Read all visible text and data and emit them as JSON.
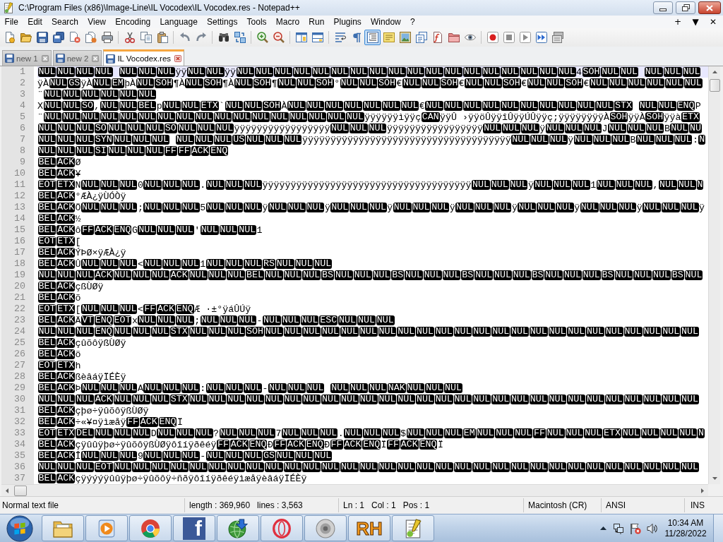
{
  "window": {
    "title": "C:\\Program Files (x86)\\Image-Line\\IL Vocodex\\IL Vocodex.res - Notepad++"
  },
  "menu": {
    "items": [
      "File",
      "Edit",
      "Search",
      "View",
      "Encoding",
      "Language",
      "Settings",
      "Tools",
      "Macro",
      "Run",
      "Plugins",
      "Window",
      "?"
    ],
    "controls": [
      "+",
      "▼",
      "✕"
    ]
  },
  "toolbar": {
    "groups": [
      {
        "buttons": [
          {
            "on": false
          },
          {
            "on": false
          },
          {
            "on": false
          },
          {
            "on": false
          },
          {
            "on": false
          },
          {
            "on": false
          },
          {
            "on": false
          }
        ]
      },
      {
        "buttons": [
          {
            "on": false
          },
          {
            "on": false
          },
          {
            "on": false
          }
        ]
      },
      {
        "buttons": [
          {
            "on": false
          },
          {
            "on": false
          }
        ]
      },
      {
        "buttons": [
          {
            "on": false
          },
          {
            "on": false
          }
        ]
      },
      {
        "buttons": [
          {
            "on": false
          },
          {
            "on": false
          }
        ]
      },
      {
        "buttons": [
          {
            "on": false
          },
          {
            "on": false
          }
        ]
      },
      {
        "buttons": [
          {
            "on": false
          },
          {
            "on": false
          },
          {
            "on": true
          },
          {
            "on": false
          },
          {
            "on": false
          },
          {
            "on": false
          },
          {
            "on": false
          },
          {
            "on": false
          },
          {
            "on": false
          }
        ]
      },
      {
        "buttons": [
          {
            "on": false
          },
          {
            "on": false
          },
          {
            "on": false
          },
          {
            "on": false
          },
          {
            "on": false
          }
        ]
      }
    ]
  },
  "tabs": [
    {
      "label": "new 1",
      "selected": false
    },
    {
      "label": "new 2",
      "selected": false
    },
    {
      "label": "IL Vocodex.res",
      "selected": true
    }
  ],
  "editor": {
    "lines": [
      {
        "number": "1",
        "current": true,
        "segments": [
          {
            "kind": "ctrl",
            "codes": [
              "NUL",
              "NUL",
              "NUL",
              "NUL"
            ]
          },
          {
            "kind": "space"
          },
          {
            "kind": "ctrl",
            "codes": [
              "NUL",
              "NUL",
              "NUL"
            ]
          },
          {
            "kind": "text",
            "text": "ÿÿ"
          },
          {
            "kind": "ctrl",
            "codes": [
              "NUL",
              "NUL"
            ]
          },
          {
            "kind": "text",
            "text": "ÿÿ"
          },
          {
            "kind": "ctrl",
            "codes": [
              "NUL",
              "NUL",
              "NUL",
              "NUL",
              "NUL",
              "NUL",
              "NUL",
              "NUL",
              "NUL",
              "NUL",
              "NUL",
              "NUL",
              "NUL",
              "NUL",
              "NUL",
              "NUL",
              "NUL",
              "NUL"
            ]
          },
          {
            "kind": "text",
            "text": "4"
          },
          {
            "kind": "ctrl",
            "codes": [
              "SOH",
              "NUL",
              "NUL"
            ]
          },
          {
            "kind": "space"
          },
          {
            "kind": "ctrl",
            "codes": [
              "NUL",
              "NUL",
              "NUL"
            ]
          }
        ]
      },
      {
        "number": "2",
        "current": false,
        "segments": [
          {
            "kind": "text",
            "text": "ÿÀ"
          },
          {
            "kind": "ctrl",
            "codes": [
              "NUL",
              "GS"
            ]
          },
          {
            "kind": "text",
            "text": "ÿÀ"
          },
          {
            "kind": "ctrl",
            "codes": [
              "NUL",
              "EM"
            ]
          },
          {
            "kind": "text",
            "text": "þÀ"
          },
          {
            "kind": "ctrl",
            "codes": [
              "NUL",
              "SOH"
            ]
          },
          {
            "kind": "text",
            "text": "¶À"
          },
          {
            "kind": "ctrl",
            "codes": [
              "NUL",
              "SOH"
            ]
          },
          {
            "kind": "text",
            "text": "¶À"
          },
          {
            "kind": "ctrl",
            "codes": [
              "NUL",
              "SOH"
            ]
          },
          {
            "kind": "text",
            "text": "¶"
          },
          {
            "kind": "ctrl",
            "codes": [
              "NUL",
              "NUL",
              "SOH"
            ]
          },
          {
            "kind": "text",
            "text": "°"
          },
          {
            "kind": "ctrl",
            "codes": [
              "NUL",
              "NUL",
              "SOH"
            ]
          },
          {
            "kind": "text",
            "text": "€"
          },
          {
            "kind": "ctrl",
            "codes": [
              "NUL",
              "NUL",
              "SOH"
            ]
          },
          {
            "kind": "text",
            "text": "€"
          },
          {
            "kind": "ctrl",
            "codes": [
              "NUL",
              "NUL",
              "SOH"
            ]
          },
          {
            "kind": "text",
            "text": "€"
          },
          {
            "kind": "ctrl",
            "codes": [
              "NUL",
              "NUL",
              "SOH"
            ]
          },
          {
            "kind": "text",
            "text": "€"
          },
          {
            "kind": "ctrl",
            "codes": [
              "NUL",
              "NUL",
              "NUL",
              "NUL",
              "NUL",
              "NUL"
            ]
          }
        ]
      },
      {
        "number": "3",
        "current": false,
        "segments": [
          {
            "kind": "text",
            "text": "¨"
          },
          {
            "kind": "ctrl",
            "codes": [
              "NUL",
              "NUL",
              "NUL",
              "NUL",
              "NUL",
              "NUL"
            ]
          }
        ]
      },
      {
        "number": "4",
        "current": false,
        "segments": [
          {
            "kind": "text",
            "text": "X"
          },
          {
            "kind": "ctrl",
            "codes": [
              "NUL",
              "NUL",
              "SO"
            ]
          },
          {
            "kind": "text",
            "text": ","
          },
          {
            "kind": "ctrl",
            "codes": [
              "NUL",
              "NUL",
              "BEL"
            ]
          },
          {
            "kind": "text",
            "text": "p"
          },
          {
            "kind": "ctrl",
            "codes": [
              "NUL",
              "NUL",
              "ETX"
            ]
          },
          {
            "kind": "text",
            "text": "`"
          },
          {
            "kind": "ctrl",
            "codes": [
              "NUL",
              "NUL",
              "SOH"
            ]
          },
          {
            "kind": "text",
            "text": "À"
          },
          {
            "kind": "ctrl",
            "codes": [
              "NUL",
              "NUL",
              "NUL",
              "NUL",
              "NUL",
              "NUL",
              "NUL"
            ]
          },
          {
            "kind": "text",
            "text": "€"
          },
          {
            "kind": "ctrl",
            "codes": [
              "NUL",
              "NUL",
              "NUL",
              "NUL",
              "NUL",
              "NUL",
              "NUL",
              "NUL",
              "NUL",
              "NUL",
              "STX"
            ]
          },
          {
            "kind": "space"
          },
          {
            "kind": "ctrl",
            "codes": [
              "NUL",
              "NUL",
              "ENQ"
            ]
          },
          {
            "kind": "text",
            "text": "P"
          }
        ]
      },
      {
        "number": "5",
        "current": false,
        "segments": [
          {
            "kind": "text",
            "text": "¨"
          },
          {
            "kind": "ctrl",
            "codes": [
              "NUL",
              "NUL",
              "NUL",
              "NUL",
              "NUL",
              "NUL",
              "NUL",
              "NUL",
              "NUL",
              "NUL",
              "NUL",
              "NUL",
              "NUL",
              "NUL",
              "NUL",
              "NUL",
              "NUL"
            ]
          },
          {
            "kind": "text",
            "text": "ÿÿÿÿÿÿìÿÿç"
          },
          {
            "kind": "ctrl",
            "codes": [
              "CAN"
            ]
          },
          {
            "kind": "text",
            "text": "ÿÿÛ ›ÿÿöÛÿÿîÛÿÿÚÛÿÿç;ÿÿÿÿÿÿÿÿÀ"
          },
          {
            "kind": "ctrl",
            "codes": [
              "SOH"
            ]
          },
          {
            "kind": "text",
            "text": "ÿÿÀ"
          },
          {
            "kind": "ctrl",
            "codes": [
              "SOH"
            ]
          },
          {
            "kind": "text",
            "text": "ÿÿà"
          },
          {
            "kind": "ctrl",
            "codes": [
              "ETX"
            ]
          }
        ]
      },
      {
        "number": "6",
        "current": false,
        "segments": [
          {
            "kind": "ctrl",
            "codes": [
              "NUL",
              "NUL",
              "NUL",
              "SO",
              "NUL",
              "NUL",
              "NUL",
              "SO",
              "NUL",
              "NUL",
              "NUL"
            ]
          },
          {
            "kind": "text",
            "text": "ÿÿÿÿÿÿÿÿÿÿÿÿÿÿÿÿÿ"
          },
          {
            "kind": "ctrl",
            "codes": [
              "NUL",
              "NUL",
              "NUL"
            ]
          },
          {
            "kind": "text",
            "text": "ÿÿÿÿÿÿÿÿÿÿÿÿÿÿÿÿÿ"
          },
          {
            "kind": "ctrl",
            "codes": [
              "NUL",
              "NUL",
              "NUL"
            ]
          },
          {
            "kind": "text",
            "text": "ÿ"
          },
          {
            "kind": "ctrl",
            "codes": [
              "NUL",
              "NUL",
              "NUL"
            ]
          },
          {
            "kind": "text",
            "text": "J"
          },
          {
            "kind": "ctrl",
            "codes": [
              "NUL",
              "NUL",
              "NUL"
            ]
          },
          {
            "kind": "text",
            "text": "B"
          },
          {
            "kind": "ctrl",
            "codes": [
              "NUL",
              "NU"
            ]
          }
        ]
      },
      {
        "number": "7",
        "current": false,
        "segments": [
          {
            "kind": "ctrl",
            "codes": [
              "NUL",
              "NUL",
              "NUL",
              "SYN",
              "NUL",
              "NUL",
              "NUL"
            ]
          },
          {
            "kind": "space"
          },
          {
            "kind": "ctrl",
            "codes": [
              "NUL",
              "NUL",
              "NUL",
              "US",
              "NUL",
              "NUL",
              "NUL"
            ]
          },
          {
            "kind": "text",
            "text": "ÿÿÿÿÿÿÿÿÿÿÿÿÿÿÿÿÿÿÿÿÿÿÿÿÿÿÿÿÿÿÿÿÿÿÿÿÿ"
          },
          {
            "kind": "ctrl",
            "codes": [
              "NUL",
              "NUL",
              "NUL"
            ]
          },
          {
            "kind": "text",
            "text": "ÿ"
          },
          {
            "kind": "ctrl",
            "codes": [
              "NUL",
              "NUL",
              "NUL"
            ]
          },
          {
            "kind": "text",
            "text": "B"
          },
          {
            "kind": "ctrl",
            "codes": [
              "NUL",
              "NUL",
              "NUL"
            ]
          },
          {
            "kind": "text",
            "text": ":"
          },
          {
            "kind": "ctrl",
            "codes": [
              "N"
            ]
          }
        ]
      },
      {
        "number": "8",
        "current": false,
        "segments": [
          {
            "kind": "ctrl",
            "codes": [
              "NUL",
              "NUL",
              "NUL",
              "SI",
              "NUL",
              "NUL",
              "NUL",
              "FF",
              "FF",
              "ACK",
              "ENQ"
            ]
          }
        ]
      },
      {
        "number": "9",
        "current": false,
        "segments": [
          {
            "kind": "ctrl",
            "codes": [
              "BEL",
              "ACK"
            ]
          },
          {
            "kind": "text",
            "text": "Ø"
          }
        ]
      },
      {
        "number": "10",
        "current": false,
        "segments": [
          {
            "kind": "ctrl",
            "codes": [
              "BEL",
              "ACK"
            ]
          },
          {
            "kind": "text",
            "text": "¥"
          }
        ]
      },
      {
        "number": "11",
        "current": false,
        "segments": [
          {
            "kind": "ctrl",
            "codes": [
              "EOT",
              "ETX"
            ]
          },
          {
            "kind": "text",
            "text": "N"
          },
          {
            "kind": "ctrl",
            "codes": [
              "NUL",
              "NUL",
              "NUL"
            ]
          },
          {
            "kind": "text",
            "text": "0"
          },
          {
            "kind": "ctrl",
            "codes": [
              "NUL",
              "NUL",
              "NUL"
            ]
          },
          {
            "kind": "text",
            "text": "."
          },
          {
            "kind": "ctrl",
            "codes": [
              "NUL",
              "NUL",
              "NUL"
            ]
          },
          {
            "kind": "text",
            "text": "ÿÿÿÿÿÿÿÿÿÿÿÿÿÿÿÿÿÿÿÿÿÿÿÿÿÿÿÿÿÿÿÿÿÿÿÿÿ"
          },
          {
            "kind": "ctrl",
            "codes": [
              "NUL",
              "NUL",
              "NUL"
            ]
          },
          {
            "kind": "text",
            "text": "ÿ"
          },
          {
            "kind": "ctrl",
            "codes": [
              "NUL",
              "NUL",
              "NUL"
            ]
          },
          {
            "kind": "text",
            "text": "1"
          },
          {
            "kind": "ctrl",
            "codes": [
              "NUL",
              "NUL",
              "NUL"
            ]
          },
          {
            "kind": "text",
            "text": ","
          },
          {
            "kind": "ctrl",
            "codes": [
              "NUL",
              "NUL",
              "N"
            ]
          }
        ]
      },
      {
        "number": "12",
        "current": false,
        "segments": [
          {
            "kind": "ctrl",
            "codes": [
              "BEL",
              "ACK"
            ]
          },
          {
            "kind": "text",
            "text": "°ÆÀ¿ÿÙÓÒÿ"
          }
        ]
      },
      {
        "number": "13",
        "current": false,
        "segments": [
          {
            "kind": "ctrl",
            "codes": [
              "BEL",
              "ACK"
            ]
          },
          {
            "kind": "text",
            "text": "Ö"
          },
          {
            "kind": "ctrl",
            "codes": [
              "NUL",
              "NUL",
              "NUL"
            ]
          },
          {
            "kind": "text",
            "text": ";"
          },
          {
            "kind": "ctrl",
            "codes": [
              "NUL",
              "NUL",
              "NUL"
            ]
          },
          {
            "kind": "text",
            "text": "5"
          },
          {
            "kind": "ctrl",
            "codes": [
              "NUL",
              "NUL",
              "NUL"
            ]
          },
          {
            "kind": "text",
            "text": "ÿ"
          },
          {
            "kind": "ctrl",
            "codes": [
              "NUL",
              "NUL",
              "NUL"
            ]
          },
          {
            "kind": "text",
            "text": "ÿ"
          },
          {
            "kind": "ctrl",
            "codes": [
              "NUL",
              "NUL",
              "NUL"
            ]
          },
          {
            "kind": "text",
            "text": "ÿ"
          },
          {
            "kind": "ctrl",
            "codes": [
              "NUL",
              "NUL",
              "NUL"
            ]
          },
          {
            "kind": "text",
            "text": "ÿ"
          },
          {
            "kind": "ctrl",
            "codes": [
              "NUL",
              "NUL",
              "NUL"
            ]
          },
          {
            "kind": "text",
            "text": "ÿ"
          },
          {
            "kind": "ctrl",
            "codes": [
              "NUL",
              "NUL",
              "NUL"
            ]
          },
          {
            "kind": "text",
            "text": "ÿ"
          },
          {
            "kind": "ctrl",
            "codes": [
              "NUL",
              "NUL",
              "NUL"
            ]
          },
          {
            "kind": "text",
            "text": "ÿ"
          },
          {
            "kind": "ctrl",
            "codes": [
              "NUL",
              "NUL",
              "NUL"
            ]
          },
          {
            "kind": "text",
            "text": "ÿ"
          }
        ]
      },
      {
        "number": "14",
        "current": false,
        "segments": [
          {
            "kind": "ctrl",
            "codes": [
              "BEL",
              "ACK"
            ]
          },
          {
            "kind": "text",
            "text": "½"
          }
        ]
      },
      {
        "number": "15",
        "current": false,
        "segments": [
          {
            "kind": "ctrl",
            "codes": [
              "BEL",
              "ACK"
            ]
          },
          {
            "kind": "text",
            "text": "ô"
          },
          {
            "kind": "ctrl",
            "codes": [
              "FF",
              "ACK",
              "ENQ"
            ]
          },
          {
            "kind": "text",
            "text": "G"
          },
          {
            "kind": "ctrl",
            "codes": [
              "NUL",
              "NUL",
              "NUL"
            ]
          },
          {
            "kind": "text",
            "text": "'"
          },
          {
            "kind": "ctrl",
            "codes": [
              "NUL",
              "NUL",
              "NUL"
            ]
          },
          {
            "kind": "text",
            "text": "1"
          }
        ]
      },
      {
        "number": "16",
        "current": false,
        "segments": [
          {
            "kind": "ctrl",
            "codes": [
              "EOT",
              "ETX"
            ]
          },
          {
            "kind": "text",
            "text": "["
          }
        ]
      },
      {
        "number": "17",
        "current": false,
        "segments": [
          {
            "kind": "ctrl",
            "codes": [
              "BEL",
              "ACK"
            ]
          },
          {
            "kind": "text",
            "text": "ÝÞØ×ÿÆÀ¿ÿ"
          }
        ]
      },
      {
        "number": "18",
        "current": false,
        "segments": [
          {
            "kind": "ctrl",
            "codes": [
              "BEL",
              "ACK"
            ]
          },
          {
            "kind": "text",
            "text": "Û"
          },
          {
            "kind": "ctrl",
            "codes": [
              "NUL",
              "NUL",
              "NUL"
            ]
          },
          {
            "kind": "text",
            "text": "<"
          },
          {
            "kind": "ctrl",
            "codes": [
              "NUL",
              "NUL",
              "NUL"
            ]
          },
          {
            "kind": "text",
            "text": "1"
          },
          {
            "kind": "ctrl",
            "codes": [
              "NUL",
              "NUL",
              "NUL",
              "RS",
              "NUL",
              "NUL",
              "NUL"
            ]
          }
        ]
      },
      {
        "number": "19",
        "current": false,
        "segments": [
          {
            "kind": "ctrl",
            "codes": [
              "NUL",
              "NUL",
              "NUL",
              "ACK",
              "NUL",
              "NUL",
              "NUL",
              "ACK",
              "NUL",
              "NUL",
              "NUL",
              "BEL",
              "NUL",
              "NUL",
              "NUL",
              "BS",
              "NUL",
              "NUL",
              "NUL",
              "BS",
              "NUL",
              "NUL",
              "NUL",
              "BS",
              "NUL",
              "NUL",
              "NUL",
              "BS",
              "NUL",
              "NUL",
              "NUL",
              "BS",
              "NUL",
              "NUL",
              "NUL",
              "BS",
              "NUL"
            ]
          }
        ]
      },
      {
        "number": "20",
        "current": false,
        "segments": [
          {
            "kind": "ctrl",
            "codes": [
              "BEL",
              "ACK"
            ]
          },
          {
            "kind": "text",
            "text": "çßÙØÿ"
          }
        ]
      },
      {
        "number": "21",
        "current": false,
        "segments": [
          {
            "kind": "ctrl",
            "codes": [
              "BEL",
              "ACK"
            ]
          },
          {
            "kind": "text",
            "text": "õ"
          }
        ]
      },
      {
        "number": "22",
        "current": false,
        "segments": [
          {
            "kind": "ctrl",
            "codes": [
              "EOT",
              "ETX"
            ]
          },
          {
            "kind": "text",
            "text": "["
          },
          {
            "kind": "ctrl",
            "codes": [
              "NUL",
              "NUL",
              "NUL"
            ]
          },
          {
            "kind": "text",
            "text": "<"
          },
          {
            "kind": "ctrl",
            "codes": [
              "FF",
              "ACK",
              "ENQ"
            ]
          },
          {
            "kind": "text",
            "text": "Æ ·±°ÿáÛÚÿ"
          }
        ]
      },
      {
        "number": "23",
        "current": false,
        "segments": [
          {
            "kind": "ctrl",
            "codes": [
              "BEL",
              "ACK"
            ]
          },
          {
            "kind": "text",
            "text": "Ä"
          },
          {
            "kind": "ctrl",
            "codes": [
              "VT",
              "ENQ",
              "EOT"
            ]
          },
          {
            "kind": "text",
            "text": "x"
          },
          {
            "kind": "ctrl",
            "codes": [
              "NUL",
              "NUL",
              "NUL"
            ]
          },
          {
            "kind": "text",
            "text": ";"
          },
          {
            "kind": "ctrl",
            "codes": [
              "NUL",
              "NUL",
              "NUL"
            ]
          },
          {
            "kind": "text",
            "text": "-"
          },
          {
            "kind": "ctrl",
            "codes": [
              "NUL",
              "NUL",
              "NUL",
              "ESC",
              "NUL",
              "NUL",
              "NUL"
            ]
          }
        ]
      },
      {
        "number": "24",
        "current": false,
        "segments": [
          {
            "kind": "ctrl",
            "codes": [
              "NUL",
              "NUL",
              "NUL",
              "ENQ",
              "NUL",
              "NUL",
              "NUL",
              "STX",
              "NUL",
              "NUL",
              "NUL",
              "SOH",
              "NUL",
              "NUL",
              "NUL",
              "NUL",
              "NUL",
              "NUL",
              "NUL",
              "NUL",
              "NUL",
              "NUL",
              "NUL",
              "NUL",
              "NUL",
              "NUL",
              "NUL",
              "NUL",
              "NUL",
              "NUL",
              "NUL",
              "NUL",
              "NUL",
              "NUL",
              "NUL"
            ]
          }
        ]
      },
      {
        "number": "25",
        "current": false,
        "segments": [
          {
            "kind": "ctrl",
            "codes": [
              "BEL",
              "ACK"
            ]
          },
          {
            "kind": "text",
            "text": "çûõôÿßÙØÿ"
          }
        ]
      },
      {
        "number": "26",
        "current": false,
        "segments": [
          {
            "kind": "ctrl",
            "codes": [
              "BEL",
              "ACK"
            ]
          },
          {
            "kind": "text",
            "text": "ö"
          }
        ]
      },
      {
        "number": "27",
        "current": false,
        "segments": [
          {
            "kind": "ctrl",
            "codes": [
              "EOT",
              "ETX"
            ]
          },
          {
            "kind": "text",
            "text": "h"
          }
        ]
      },
      {
        "number": "28",
        "current": false,
        "segments": [
          {
            "kind": "ctrl",
            "codes": [
              "BEL",
              "ACK"
            ]
          },
          {
            "kind": "text",
            "text": "ßèâáÿÏÉÈÿ"
          }
        ]
      },
      {
        "number": "29",
        "current": false,
        "segments": [
          {
            "kind": "ctrl",
            "codes": [
              "BEL",
              "ACK"
            ]
          },
          {
            "kind": "text",
            "text": "Þ"
          },
          {
            "kind": "ctrl",
            "codes": [
              "NUL",
              "NUL",
              "NUL"
            ]
          },
          {
            "kind": "text",
            "text": "A"
          },
          {
            "kind": "ctrl",
            "codes": [
              "NUL",
              "NUL",
              "NUL"
            ]
          },
          {
            "kind": "text",
            "text": ":"
          },
          {
            "kind": "ctrl",
            "codes": [
              "NUL",
              "NUL",
              "NUL"
            ]
          },
          {
            "kind": "text",
            "text": "-"
          },
          {
            "kind": "ctrl",
            "codes": [
              "NUL",
              "NUL",
              "NUL"
            ]
          },
          {
            "kind": "space"
          },
          {
            "kind": "ctrl",
            "codes": [
              "NUL",
              "NUL",
              "NUL",
              "NAK",
              "NUL",
              "NUL",
              "NUL"
            ]
          }
        ]
      },
      {
        "number": "30",
        "current": false,
        "segments": [
          {
            "kind": "ctrl",
            "codes": [
              "NUL",
              "NUL",
              "NUL",
              "ACK",
              "NUL",
              "NUL",
              "NUL",
              "STX",
              "NUL",
              "NUL",
              "NUL",
              "NUL",
              "NUL",
              "NUL",
              "NUL",
              "NUL",
              "NUL",
              "NUL",
              "NUL",
              "NUL",
              "NUL",
              "NUL",
              "NUL",
              "NUL",
              "NUL",
              "NUL",
              "NUL",
              "NUL",
              "NUL",
              "NUL",
              "NUL",
              "NUL",
              "NUL",
              "NUL",
              "NUL"
            ]
          }
        ]
      },
      {
        "number": "31",
        "current": false,
        "segments": [
          {
            "kind": "ctrl",
            "codes": [
              "BEL",
              "ACK"
            ]
          },
          {
            "kind": "text",
            "text": "çþø÷ÿûõôÿßÙØÿ"
          }
        ]
      },
      {
        "number": "32",
        "current": false,
        "segments": [
          {
            "kind": "ctrl",
            "codes": [
              "BEL",
              "ACK"
            ]
          },
          {
            "kind": "text",
            "text": "÷«¥¤ÿìæåÿ"
          },
          {
            "kind": "ctrl",
            "codes": [
              "FF",
              "ACK",
              "ENQ"
            ]
          },
          {
            "kind": "text",
            "text": "Ï"
          }
        ]
      },
      {
        "number": "33",
        "current": false,
        "segments": [
          {
            "kind": "ctrl",
            "codes": [
              "EOT",
              "ETX",
              "DEL",
              "NUL",
              "NUL",
              "NUL"
            ]
          },
          {
            "kind": "text",
            "text": "D"
          },
          {
            "kind": "ctrl",
            "codes": [
              "NUL",
              "NUL",
              "NUL"
            ]
          },
          {
            "kind": "text",
            "text": "?"
          },
          {
            "kind": "ctrl",
            "codes": [
              "NUL",
              "NUL",
              "NUL"
            ]
          },
          {
            "kind": "text",
            "text": "7"
          },
          {
            "kind": "ctrl",
            "codes": [
              "NUL",
              "NUL",
              "NUL"
            ]
          },
          {
            "kind": "text",
            "text": "."
          },
          {
            "kind": "ctrl",
            "codes": [
              "NUL",
              "NUL",
              "NUL"
            ]
          },
          {
            "kind": "text",
            "text": "$"
          },
          {
            "kind": "ctrl",
            "codes": [
              "NUL",
              "NUL",
              "NUL",
              "EM",
              "NUL",
              "NUL",
              "NUL",
              "FF",
              "NUL",
              "NUL",
              "NUL",
              "ETX",
              "NUL",
              "NUL",
              "NUL",
              "NUL",
              "N"
            ]
          }
        ]
      },
      {
        "number": "34",
        "current": false,
        "segments": [
          {
            "kind": "ctrl",
            "codes": [
              "BEL",
              "ACK"
            ]
          },
          {
            "kind": "text",
            "text": "çÿûûÿþø÷ÿûõôÿßÙØÿôîíÿðêéÿ"
          },
          {
            "kind": "ctrl",
            "codes": [
              "FF",
              "ACK",
              "ENQ"
            ]
          },
          {
            "kind": "text",
            "text": "Ð"
          },
          {
            "kind": "ctrl",
            "codes": [
              "FF",
              "ACK",
              "ENQ"
            ]
          },
          {
            "kind": "text",
            "text": "Ð"
          },
          {
            "kind": "ctrl",
            "codes": [
              "FF",
              "ACK",
              "ENQ"
            ]
          },
          {
            "kind": "text",
            "text": "Ï"
          },
          {
            "kind": "ctrl",
            "codes": [
              "FF",
              "ACK",
              "ENQ"
            ]
          },
          {
            "kind": "text",
            "text": "Ï"
          }
        ]
      },
      {
        "number": "35",
        "current": false,
        "segments": [
          {
            "kind": "ctrl",
            "codes": [
              "BEL",
              "ACK"
            ]
          },
          {
            "kind": "text",
            "text": "Î"
          },
          {
            "kind": "ctrl",
            "codes": [
              "NUL",
              "NUL",
              "NUL"
            ]
          },
          {
            "kind": "text",
            "text": "9"
          },
          {
            "kind": "ctrl",
            "codes": [
              "NUL",
              "NUL",
              "NUL"
            ]
          },
          {
            "kind": "text",
            "text": "-"
          },
          {
            "kind": "ctrl",
            "codes": [
              "NUL",
              "NUL",
              "NUL",
              "GS",
              "NUL",
              "NUL",
              "NUL"
            ]
          }
        ]
      },
      {
        "number": "36",
        "current": false,
        "segments": [
          {
            "kind": "ctrl",
            "codes": [
              "NUL",
              "NUL",
              "NUL",
              "EOT",
              "NUL",
              "NUL",
              "NUL",
              "NUL",
              "NUL",
              "NUL",
              "NUL",
              "NUL",
              "NUL",
              "NUL",
              "NUL",
              "NUL",
              "NUL",
              "NUL",
              "NUL",
              "NUL",
              "NUL",
              "NUL",
              "NUL",
              "NUL",
              "NUL",
              "NUL",
              "NUL",
              "NUL",
              "NUL",
              "NUL",
              "NUL",
              "NUL",
              "NUL",
              "NUL",
              "NUL"
            ]
          }
        ]
      },
      {
        "number": "37",
        "current": false,
        "segments": [
          {
            "kind": "ctrl",
            "codes": [
              "BEL",
              "ACK"
            ]
          },
          {
            "kind": "text",
            "text": "çÿýýýÿûûÿþø÷ÿûõôÿ÷ñðÿôîíÿðêéÿìæåÿèâáÿÏÉÈÿ"
          }
        ]
      }
    ]
  },
  "status_bar": {
    "panels": [
      {
        "texts": [
          "Normal text file"
        ]
      },
      {
        "texts": [
          "length : 369,960",
          "lines : 3,563"
        ]
      },
      {
        "texts": [
          "Ln : 1",
          "Col : 1",
          "Pos : 1"
        ]
      },
      {
        "texts": [
          "Macintosh (CR)"
        ]
      },
      {
        "texts": [
          "ANSI"
        ]
      },
      {
        "texts": [
          "INS"
        ]
      }
    ]
  },
  "taskbar": {
    "apps": [
      {
        "kind": "folder"
      },
      {
        "kind": "media"
      },
      {
        "kind": "browser"
      },
      {
        "kind": "tile",
        "glyph": "f"
      },
      {
        "kind": "download"
      },
      {
        "kind": "ring"
      },
      {
        "kind": "speaker"
      },
      {
        "kind": "wordmark",
        "glyph": "RH"
      },
      {
        "kind": "notepad"
      }
    ],
    "clock": {
      "time": "10:34 AM",
      "date": "11/28/2022"
    }
  }
}
